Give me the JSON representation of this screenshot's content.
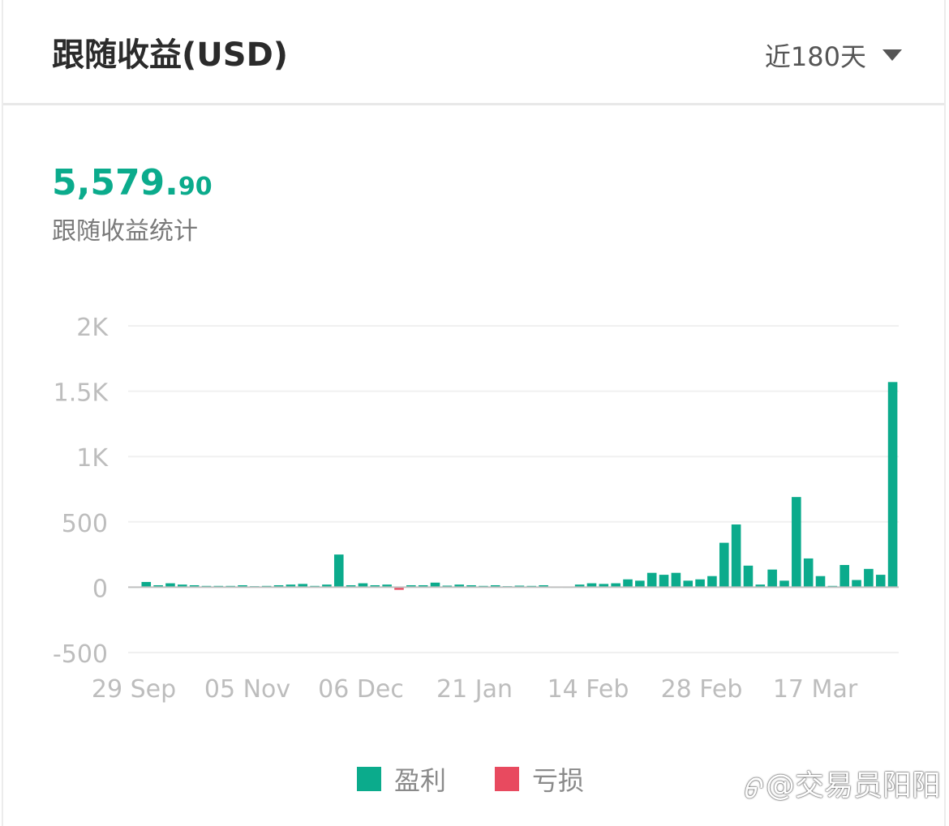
{
  "header": {
    "title": "跟随收益(USD)",
    "period_label": "近180天"
  },
  "summary": {
    "total_int": "5,579.",
    "total_dec": "90",
    "caption": "跟随收益统计"
  },
  "legend": {
    "profit_label": "盈利",
    "loss_label": "亏损"
  },
  "watermark": {
    "logo": "ᠪ",
    "text": "@交易员阳阳"
  },
  "colors": {
    "profit": "#0bab8c",
    "loss": "#e84a5f",
    "grid": "#f0f0f0",
    "axis": "#c0c0c0",
    "tick": "#bdbdbd"
  },
  "chart_data": {
    "type": "bar",
    "ylim": [
      -500,
      2000
    ],
    "y_ticks": [
      2000,
      1500,
      1000,
      500,
      0,
      -500
    ],
    "y_tick_labels": [
      "2K",
      "1.5K",
      "1K",
      "500",
      "0",
      "-500"
    ],
    "x_tick_labels": [
      "29 Sep",
      "05 Nov",
      "06 Dec",
      "21 Jan",
      "14 Feb",
      "28 Feb",
      "17 Mar"
    ],
    "grid": true,
    "values": [
      5,
      40,
      15,
      30,
      20,
      15,
      10,
      10,
      10,
      15,
      8,
      10,
      15,
      20,
      25,
      10,
      20,
      250,
      15,
      30,
      15,
      20,
      -20,
      15,
      15,
      35,
      12,
      20,
      15,
      10,
      15,
      8,
      12,
      10,
      15,
      5,
      5,
      20,
      30,
      25,
      30,
      60,
      50,
      110,
      95,
      110,
      50,
      60,
      85,
      340,
      480,
      165,
      20,
      135,
      50,
      690,
      220,
      85,
      10,
      170,
      55,
      140,
      95,
      1570
    ]
  }
}
